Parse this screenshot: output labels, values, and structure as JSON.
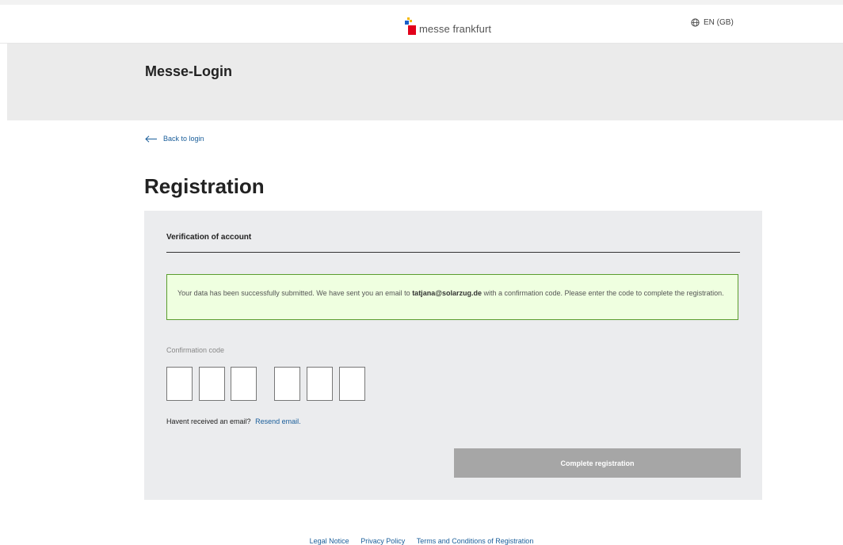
{
  "header": {
    "logo_text": "messe frankfurt",
    "language": "EN (GB)"
  },
  "hero": {
    "title": "Messe-Login"
  },
  "back_link": "Back to login",
  "page_title": "Registration",
  "form": {
    "section_title": "Verification of account",
    "alert": {
      "text_before": "Your data has been successfully submitted. We have sent you an email to ",
      "email": "tatjana@solarzug.de",
      "text_after": " with a confirmation code. Please enter the code to complete the registration."
    },
    "code_label": "Confirmation code",
    "code_digits": [
      "",
      "",
      "",
      "",
      "",
      ""
    ],
    "resend_prompt": "Havent received an email?",
    "resend_link": "Resend email.",
    "submit_label": "Complete registration"
  },
  "footer": {
    "links": [
      "Legal Notice",
      "Privacy Policy",
      "Terms and Conditions of Registration"
    ]
  },
  "colors": {
    "link": "#1a5e9a",
    "alert_bg": "#efffe0",
    "alert_border": "#5a9d2e",
    "button_disabled": "#a6a6a6",
    "logo_red": "#e2001a",
    "logo_blue": "#1a5ec8",
    "logo_yellow": "#f5b800"
  }
}
